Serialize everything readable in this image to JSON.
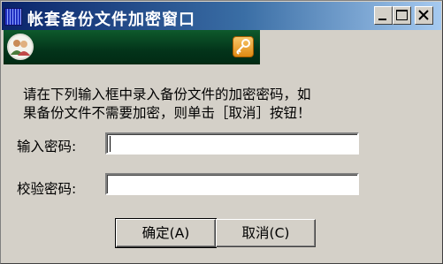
{
  "window": {
    "title": "帐套备份文件加密窗口",
    "icons": {
      "app": "app-icon",
      "minimize": "minimize-icon",
      "maximize": "maximize-icon",
      "close": "close-icon"
    }
  },
  "banner": {
    "left_icon": "users-icon",
    "right_icon": "key-icon"
  },
  "message": {
    "line1": "请在下列输入框中录入备份文件的加密密码，如",
    "line2": "果备份文件不需要加密，则单击［取消］按钮！"
  },
  "form": {
    "password_label": "输入密码:",
    "password_value": "",
    "verify_label": "校验密码:",
    "verify_value": ""
  },
  "buttons": {
    "ok_label": "确定(A)",
    "cancel_label": "取消(C)"
  }
}
